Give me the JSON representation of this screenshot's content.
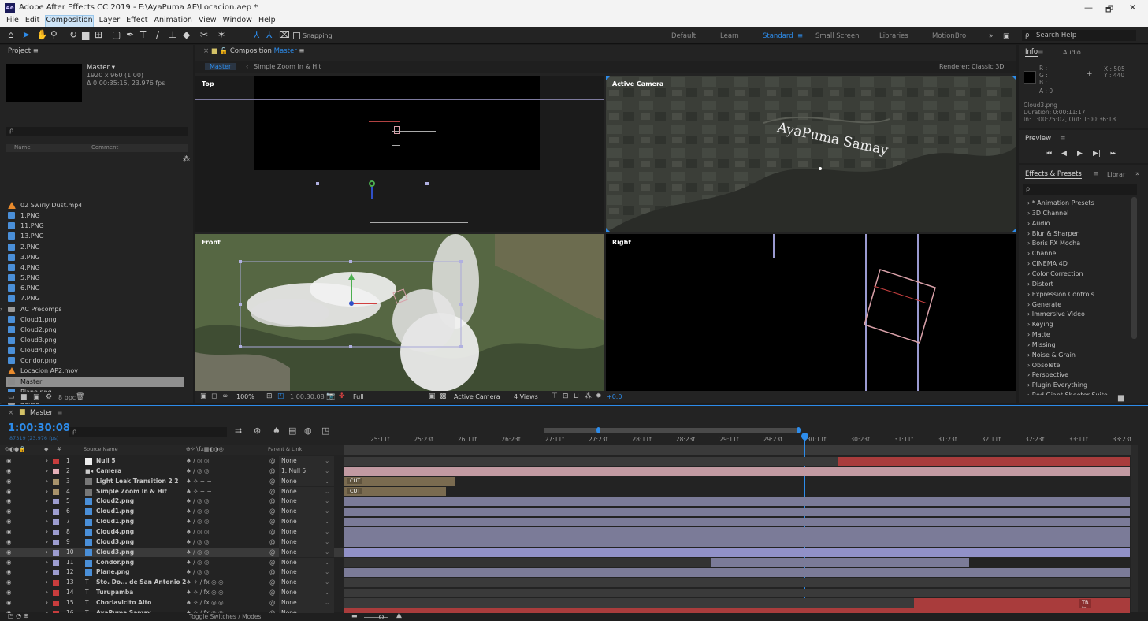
{
  "window": {
    "title": "Adobe After Effects CC 2019 - F:\\AyaPuma AE\\Locacion.aep *",
    "minimize": "—",
    "maximize": "🗗",
    "close": "✕"
  },
  "menu": [
    "File",
    "Edit",
    "Composition",
    "Layer",
    "Effect",
    "Animation",
    "View",
    "Window",
    "Help"
  ],
  "toolbar": {
    "snapping_label": "Snapping",
    "workspaces": [
      "Default",
      "Learn",
      "Standard",
      "Small Screen",
      "Libraries",
      "MotionBro"
    ],
    "active_workspace": "Standard",
    "search_placeholder": "Search Help"
  },
  "project": {
    "header": "Project  ≡",
    "comp_name": "Master ▾",
    "comp_size": "1920 x 960 (1.00)",
    "comp_duration": "Δ 0:00:35:15, 23.976 fps",
    "search_icon": "ρ.",
    "col_name": "Name",
    "col_comment": "Comment",
    "bpc": "8 bpc",
    "items": [
      {
        "name": "02 Swirly Dust.mp4",
        "type": "mp4"
      },
      {
        "name": "1.PNG",
        "type": "png"
      },
      {
        "name": "11.PNG",
        "type": "png"
      },
      {
        "name": "13.PNG",
        "type": "png"
      },
      {
        "name": "2.PNG",
        "type": "png"
      },
      {
        "name": "3.PNG",
        "type": "png"
      },
      {
        "name": "4.PNG",
        "type": "png"
      },
      {
        "name": "5.PNG",
        "type": "png"
      },
      {
        "name": "6.PNG",
        "type": "png"
      },
      {
        "name": "7.PNG",
        "type": "png"
      },
      {
        "name": "AC Precomps",
        "type": "folder"
      },
      {
        "name": "Cloud1.png",
        "type": "png"
      },
      {
        "name": "Cloud2.png",
        "type": "png"
      },
      {
        "name": "Cloud3.png",
        "type": "png"
      },
      {
        "name": "Cloud4.png",
        "type": "png"
      },
      {
        "name": "Condor.png",
        "type": "png"
      },
      {
        "name": "Locacion AP2.mov",
        "type": "mp4"
      },
      {
        "name": "Master",
        "type": "comp"
      },
      {
        "name": "Plane.png",
        "type": "png"
      },
      {
        "name": "Solids",
        "type": "folder"
      }
    ]
  },
  "composition": {
    "header": "Composition",
    "header_name": "Master",
    "breadcrumb_active": "Master",
    "breadcrumb_next": "Simple Zoom In & Hit",
    "renderer_label": "Renderer:",
    "renderer_value": "Classic 3D",
    "views": {
      "top": "Top",
      "active_camera": "Active Camera",
      "front": "Front",
      "right": "Right"
    },
    "overlay_text": "AyaPuma Samay",
    "bottom_bar": {
      "zoom": "100%",
      "timecode": "1:00:30:08",
      "resolution": "Full",
      "camera": "Active Camera",
      "views": "4 Views",
      "exposure": "+0.0"
    }
  },
  "info": {
    "tab_info": "Info",
    "tab_audio": "Audio",
    "r": "R :",
    "g": "G :",
    "b": "B :",
    "a": "A : 0",
    "x": "X : 505",
    "y": "Y : 440",
    "item_name": "Cloud3.png",
    "duration": "Duration: 0:00:11:17",
    "inout": "In: 1:00:25:02, Out: 1:00:36:18"
  },
  "preview": {
    "header": "Preview"
  },
  "effects": {
    "tab": "Effects & Presets",
    "tab2": "Librar",
    "search_icon": "ρ.",
    "items": [
      "* Animation Presets",
      "3D Channel",
      "Audio",
      "Blur & Sharpen",
      "Boris FX Mocha",
      "Channel",
      "CINEMA 4D",
      "Color Correction",
      "Distort",
      "Expression Controls",
      "Generate",
      "Immersive Video",
      "Keying",
      "Matte",
      "Missing",
      "Noise & Grain",
      "Obsolete",
      "Perspective",
      "Plugin Everything",
      "Red Giant Shooter Suite"
    ]
  },
  "timeline": {
    "tab": "Master",
    "timecode": "1:00:30:08",
    "frames": "87319 (23.976 fps)",
    "search_icon": "ρ.",
    "col_source": "Source Name",
    "col_parent": "Parent & Link",
    "toggle_label": "Toggle Switches / Modes",
    "ruler": [
      "25:11f",
      "25:23f",
      "26:11f",
      "26:23f",
      "27:11f",
      "27:23f",
      "28:11f",
      "28:23f",
      "29:11f",
      "29:23f",
      "30:11f",
      "30:23f",
      "31:11f",
      "31:23f",
      "32:11f",
      "32:23f",
      "33:11f",
      "33:23f"
    ],
    "cut_label": "CUT",
    "tr_label": "TR In",
    "layers": [
      {
        "num": "1",
        "name": "Null 5",
        "color": "#c83d3d",
        "parent": "None"
      },
      {
        "num": "2",
        "name": "Camera",
        "color": "#e6b0b8",
        "parent": "1. Null 5"
      },
      {
        "num": "3",
        "name": "Light Leak Transition 2 2",
        "color": "#a8936b",
        "parent": "None"
      },
      {
        "num": "4",
        "name": "Simple Zoom In & Hit",
        "color": "#a8936b",
        "parent": "None"
      },
      {
        "num": "5",
        "name": "Cloud2.png",
        "color": "#9d9dd0",
        "parent": "None"
      },
      {
        "num": "6",
        "name": "Cloud1.png",
        "color": "#9d9dd0",
        "parent": "None"
      },
      {
        "num": "7",
        "name": "Cloud1.png",
        "color": "#9d9dd0",
        "parent": "None"
      },
      {
        "num": "8",
        "name": "Cloud4.png",
        "color": "#9d9dd0",
        "parent": "None"
      },
      {
        "num": "9",
        "name": "Cloud3.png",
        "color": "#9d9dd0",
        "parent": "None"
      },
      {
        "num": "10",
        "name": "Cloud3.png",
        "color": "#9d9dd0",
        "parent": "None"
      },
      {
        "num": "11",
        "name": "Condor.png",
        "color": "#9d9dd0",
        "parent": "None"
      },
      {
        "num": "12",
        "name": "Plane.png",
        "color": "#9d9dd0",
        "parent": "None"
      },
      {
        "num": "13",
        "name": "Sto. Do... de San Antonio 2",
        "color": "#c83d3d",
        "parent": "None"
      },
      {
        "num": "14",
        "name": "Turupamba",
        "color": "#c83d3d",
        "parent": "None"
      },
      {
        "num": "15",
        "name": "Chorlavicito Alto",
        "color": "#c83d3d",
        "parent": "None"
      },
      {
        "num": "16",
        "name": "AyaPuma Samay",
        "color": "#c83d3d",
        "parent": "None"
      }
    ]
  }
}
